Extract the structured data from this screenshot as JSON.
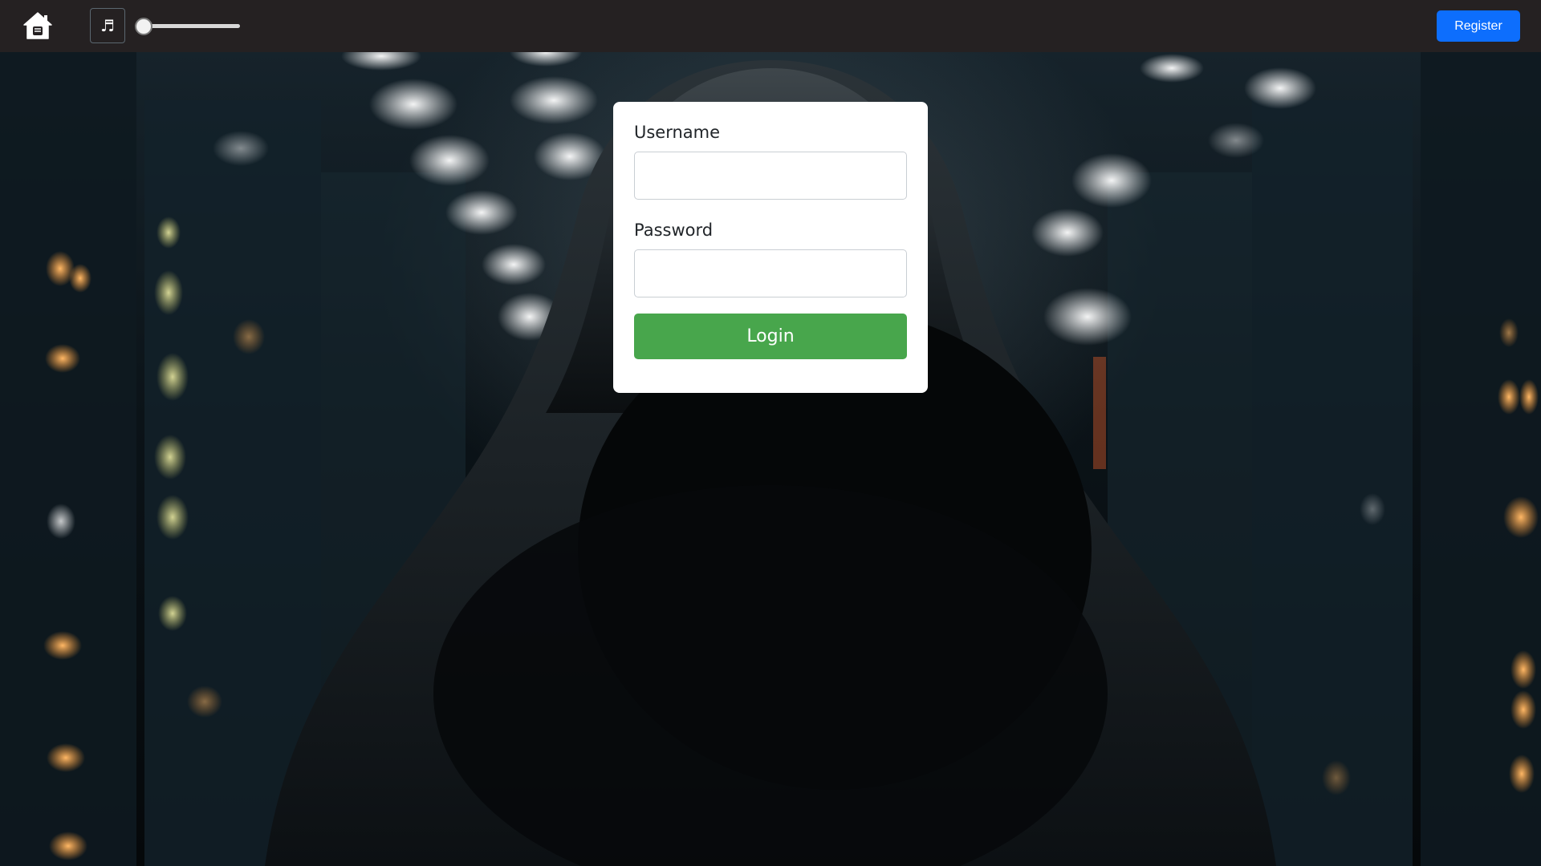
{
  "header": {
    "home_icon": "home-icon",
    "music_icon": "music-note-icon",
    "music_glyph": "♬",
    "volume_level": 0.0,
    "register_label": "Register"
  },
  "login_form": {
    "username_label": "Username",
    "username_value": "",
    "password_label": "Password",
    "password_value": "",
    "login_label": "Login"
  },
  "colors": {
    "topbar": "#252122",
    "register_button": "#0d6efd",
    "login_button": "#48a64c"
  }
}
